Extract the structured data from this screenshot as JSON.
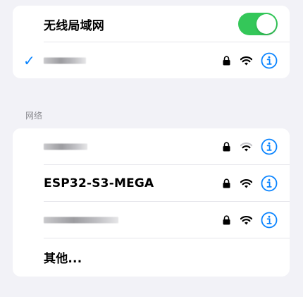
{
  "wlan": {
    "title": "无线局域网",
    "enabled": true,
    "connected_network": {
      "name_redacted": true,
      "checkmark": "✓",
      "icons": [
        "lock-icon",
        "wifi-icon",
        "info-icon"
      ]
    }
  },
  "networks_section": {
    "header": "网络",
    "items": [
      {
        "name": "",
        "name_redacted": true,
        "signal_bars": 2,
        "icons": [
          "lock-icon",
          "wifi-icon",
          "info-icon"
        ]
      },
      {
        "name": "ESP32-S3-MEGA",
        "name_redacted": false,
        "signal_bars": 3,
        "icons": [
          "lock-icon",
          "wifi-icon",
          "info-icon"
        ]
      },
      {
        "name": "",
        "name_redacted": true,
        "signal_bars": 3,
        "icons": [
          "lock-icon",
          "wifi-icon",
          "info-icon"
        ]
      }
    ],
    "other_label": "其他..."
  },
  "colors": {
    "accent": "#0a84ff",
    "toggle_on": "#34c759",
    "background": "#f2f2f7",
    "card": "#ffffff",
    "wifi_dim": "#c7c7cc"
  }
}
